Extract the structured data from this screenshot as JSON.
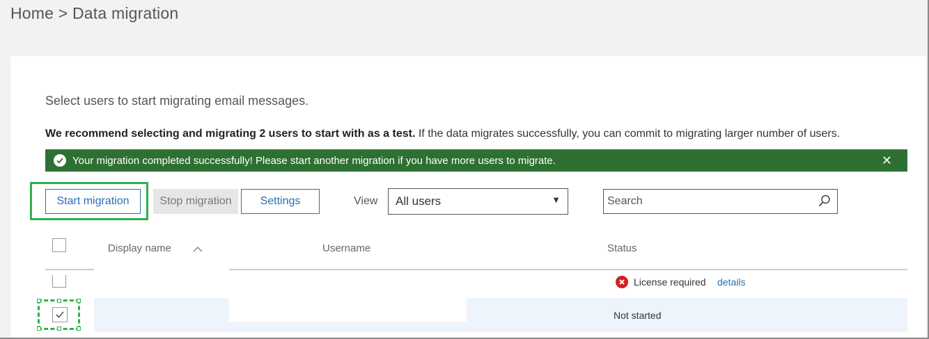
{
  "breadcrumb": {
    "home": "Home",
    "separator": ">",
    "current": "Data migration"
  },
  "intro": "Select users to start migrating email messages.",
  "recommendation": {
    "bold": "We recommend selecting and migrating 2 users to start with as a test.",
    "rest": "If the data migrates successfully, you can commit to migrating larger number of users."
  },
  "banner": {
    "message": "Your migration completed successfully! Please start another migration if you have more users to migrate.",
    "color": "#2e7032"
  },
  "toolbar": {
    "start_label": "Start migration",
    "stop_label": "Stop migration",
    "settings_label": "Settings",
    "view_label": "View",
    "view_selected": "All users",
    "search_placeholder": "Search"
  },
  "table": {
    "columns": [
      "Display name",
      "Username",
      "Status"
    ],
    "rows": [
      {
        "display_name": "",
        "username": "",
        "status": "License required",
        "link": "details",
        "checked": false
      },
      {
        "display_name": "",
        "username": "",
        "status": "Not started",
        "checked": true
      }
    ]
  },
  "colors": {
    "accent": "#2a6fb5",
    "highlight": "#2db14c",
    "error": "#d71e1e"
  }
}
